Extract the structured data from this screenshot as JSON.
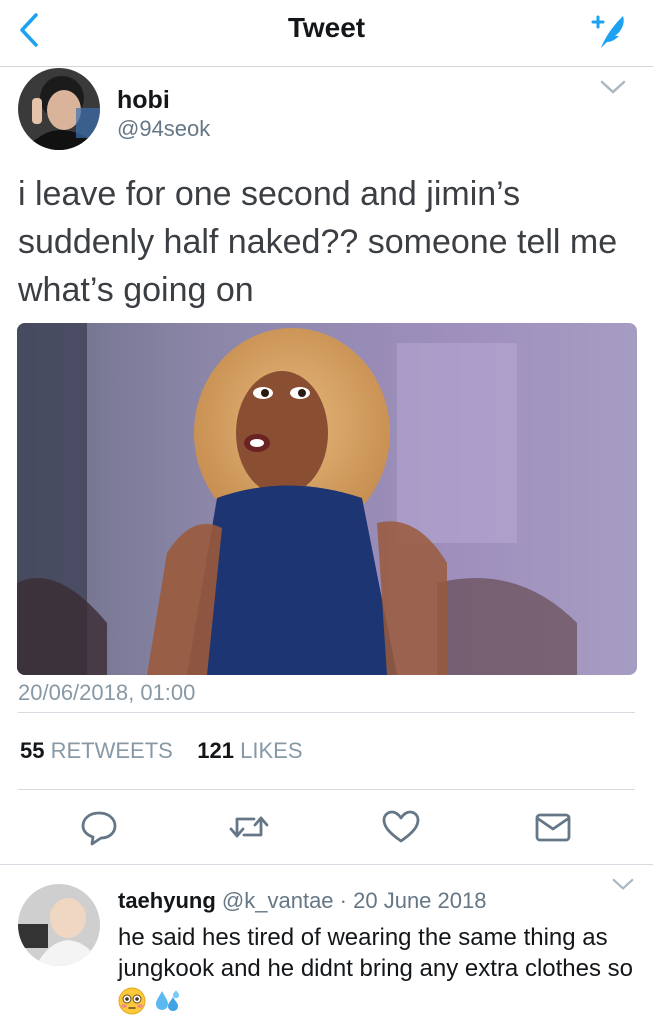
{
  "header": {
    "title": "Tweet",
    "back_icon": "chevron-left-icon",
    "compose_icon": "compose-tweet-icon",
    "accent": "#1da1f2"
  },
  "tweet": {
    "name": "hobi",
    "handle": "@94seok",
    "text": "i leave for one second and jimin’s suddenly half naked?? someone tell me what’s going on",
    "media_icon": "reaction-gif-image",
    "timestamp": "20/06/2018, 01:00",
    "retweets_count": "55",
    "retweets_label": "RETWEETS",
    "likes_count": "121",
    "likes_label": "LIKES"
  },
  "actions": {
    "reply": "reply-icon",
    "retweet": "retweet-icon",
    "like": "heart-icon",
    "dm": "envelope-icon"
  },
  "reply": {
    "name": "taehyung",
    "handle": "@k_vantae",
    "separator": "·",
    "date": "20 June 2018",
    "text": "he said hes tired of wearing the same thing as jungkook and he didnt bring any extra clothes so",
    "emoji_1": "flushed-face-emoji",
    "emoji_2": "sweat-droplets-emoji"
  }
}
